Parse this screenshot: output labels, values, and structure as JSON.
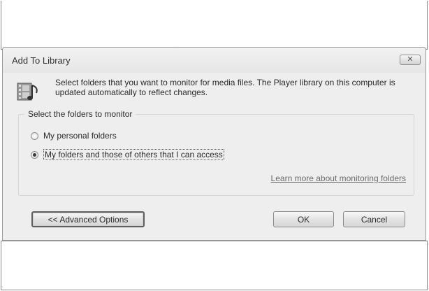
{
  "dialog": {
    "title": "Add To Library",
    "close_label": "✕",
    "intro": "Select folders that you want to monitor for media files. The Player library on this computer is updated automatically to reflect changes.",
    "group_label": "Select the folders to monitor",
    "options": [
      {
        "label": "My personal folders",
        "checked": false
      },
      {
        "label": "My folders and those of others that I can access",
        "checked": true
      }
    ],
    "learn_more": "Learn more about monitoring folders",
    "buttons": {
      "advanced": "<< Advanced Options",
      "ok": "OK",
      "cancel": "Cancel"
    }
  },
  "icons": {
    "dialog_icon": "media-library-icon",
    "close": "close-icon"
  }
}
